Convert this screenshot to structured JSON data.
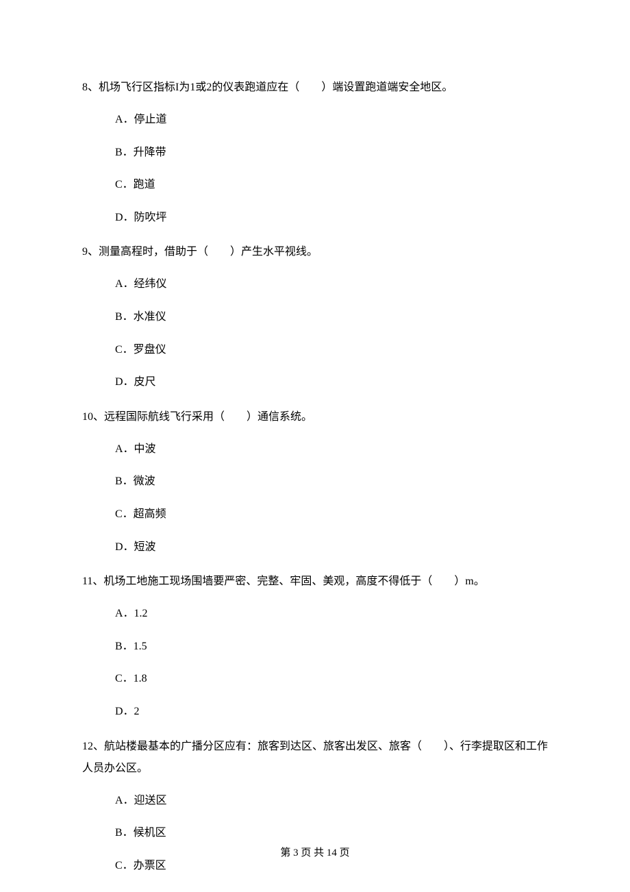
{
  "questions": [
    {
      "stem": "8、机场飞行区指标I为1或2的仪表跑道应在（　　）端设置跑道端安全地区。",
      "options": [
        "A．停止道",
        "B．升降带",
        "C．跑道",
        "D．防吹坪"
      ]
    },
    {
      "stem": "9、测量高程时，借助于（　　）产生水平视线。",
      "options": [
        "A．经纬仪",
        "B．水准仪",
        "C．罗盘仪",
        "D．皮尺"
      ]
    },
    {
      "stem": "10、远程国际航线飞行采用（　　）通信系统。",
      "options": [
        "A．中波",
        "B．微波",
        "C．超高频",
        "D．短波"
      ]
    },
    {
      "stem": "11、机场工地施工现场围墙要严密、完整、牢固、美观，高度不得低于（　　）m。",
      "options": [
        "A．1.2",
        "B．1.5",
        "C．1.8",
        "D．2"
      ]
    },
    {
      "stem": "12、航站楼最基本的广播分区应有：旅客到达区、旅客出发区、旅客（　　）、行李提取区和工作人员办公区。",
      "options": [
        "A．迎送区",
        "B．候机区",
        "C．办票区"
      ]
    }
  ],
  "footer": "第 3 页 共 14 页"
}
